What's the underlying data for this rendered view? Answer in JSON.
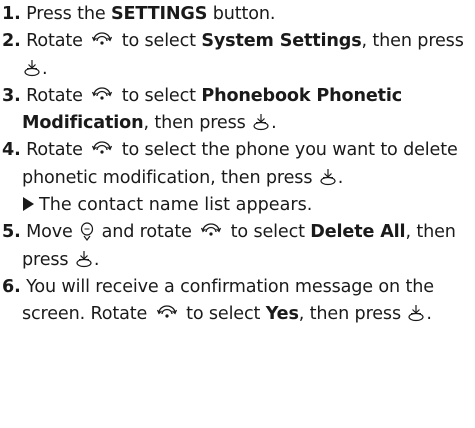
{
  "steps": [
    {
      "num": "1.",
      "parts": [
        "Press the ",
        "SETTINGS",
        " button."
      ]
    },
    {
      "num": "2.",
      "parts": [
        "Rotate ",
        " to select ",
        "System Settings",
        ", then press ",
        "."
      ]
    },
    {
      "num": "3.",
      "parts": [
        "Rotate ",
        " to select ",
        "Phonebook Phonetic Modification",
        ", then press ",
        "."
      ]
    },
    {
      "num": "4.",
      "parts": [
        "Rotate ",
        " to select the phone you want to delete phonetic modification, then press ",
        "."
      ]
    },
    {
      "num": "5.",
      "parts": [
        "Move ",
        " and rotate ",
        " to select ",
        "Delete All",
        ", then press ",
        "."
      ]
    },
    {
      "num": "6.",
      "parts": [
        "You will receive a confirmation message on the screen. Rotate ",
        " to select ",
        "Yes",
        ", then press ",
        "."
      ]
    }
  ],
  "result_text": "The contact name list appears.",
  "icons": {
    "dial": "interface-dial-rotate-icon",
    "enter": "enter-press-icon",
    "move": "move-icon",
    "result_arrow": "result-arrow-icon"
  }
}
